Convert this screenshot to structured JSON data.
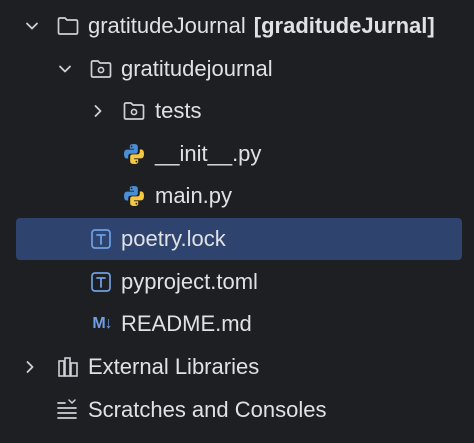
{
  "tree": {
    "items": [
      {
        "label": "gratitudeJournal",
        "suffix": "[graditudeJurnal]"
      },
      {
        "label": "gratitudejournal"
      },
      {
        "label": "tests"
      },
      {
        "label": "__init__.py"
      },
      {
        "label": "main.py"
      },
      {
        "label": "poetry.lock"
      },
      {
        "label": "pyproject.toml"
      },
      {
        "label": "README.md",
        "icon_text": "M↓"
      },
      {
        "label": "External Libraries"
      },
      {
        "label": "Scratches and Consoles"
      }
    ]
  },
  "colors": {
    "background": "#1e1f22",
    "selection": "#2e436e",
    "text": "#dfe1e5",
    "icon_gray": "#ced0d6",
    "icon_blue": "#6f9fe4"
  }
}
